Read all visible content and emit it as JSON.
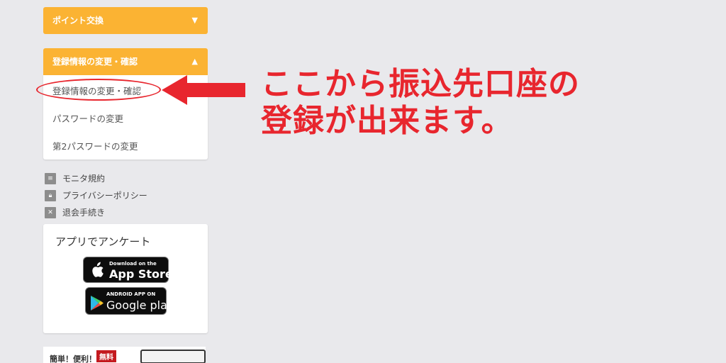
{
  "sidebar": {
    "points_panel": {
      "title": "ポイント交換",
      "arrow": "▼"
    },
    "registration_panel": {
      "title": "登録情報の変更・確認",
      "arrow": "▲",
      "items": [
        {
          "label": "登録情報の変更・確認"
        },
        {
          "label": "パスワードの変更"
        },
        {
          "label": "第2パスワードの変更"
        }
      ]
    },
    "links": [
      {
        "label": "モニタ規約",
        "icon": "document-icon"
      },
      {
        "label": "プライバシーポリシー",
        "icon": "lock-icon"
      },
      {
        "label": "退会手続き",
        "icon": "close-icon"
      }
    ],
    "app_box": {
      "title": "アプリでアンケート",
      "app_store": {
        "small": "Download on the",
        "big": "App Store"
      },
      "google_play": {
        "small": "ANDROID APP ON",
        "big": "Google play"
      }
    },
    "promo": {
      "text": "簡単！便利！",
      "badge": "無料"
    }
  },
  "annotation": {
    "line1": "ここから振込先口座の",
    "line2": "登録が出来ます。",
    "color": "#e8262e"
  },
  "colors": {
    "accent": "#fbb333",
    "background": "#e9e9ec",
    "annotation_red": "#e8262e"
  }
}
